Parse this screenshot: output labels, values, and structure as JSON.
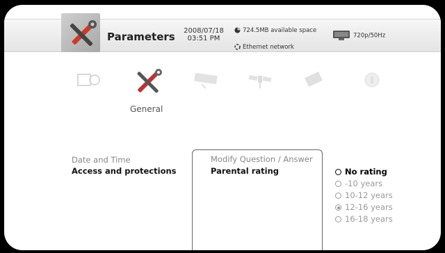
{
  "header": {
    "title": "Parameters",
    "date": "2008/07/18",
    "time": "03:51 PM",
    "available_space": "724.5MB available space",
    "network": "Ethernet network",
    "video_mode": "720p/50Hz"
  },
  "categories": {
    "selected_label": "General",
    "icons": [
      "tv-settings-icon",
      "tools-icon",
      "receiver-icon",
      "satellite-icon",
      "chip-icon",
      "info-icon"
    ]
  },
  "menu": {
    "items": [
      {
        "label": "Date and Time"
      },
      {
        "label": "Access and protections"
      }
    ]
  },
  "panel": {
    "items": [
      {
        "label": "Modify Question / Answer"
      },
      {
        "label": "Parental rating"
      }
    ]
  },
  "ratings": {
    "options": [
      {
        "label": "No rating"
      },
      {
        "label": "-10 years"
      },
      {
        "label": "10-12  years"
      },
      {
        "label": "12-16  years"
      },
      {
        "label": "16-18  years"
      }
    ],
    "highlighted_index": 0,
    "checked_index": 3
  }
}
